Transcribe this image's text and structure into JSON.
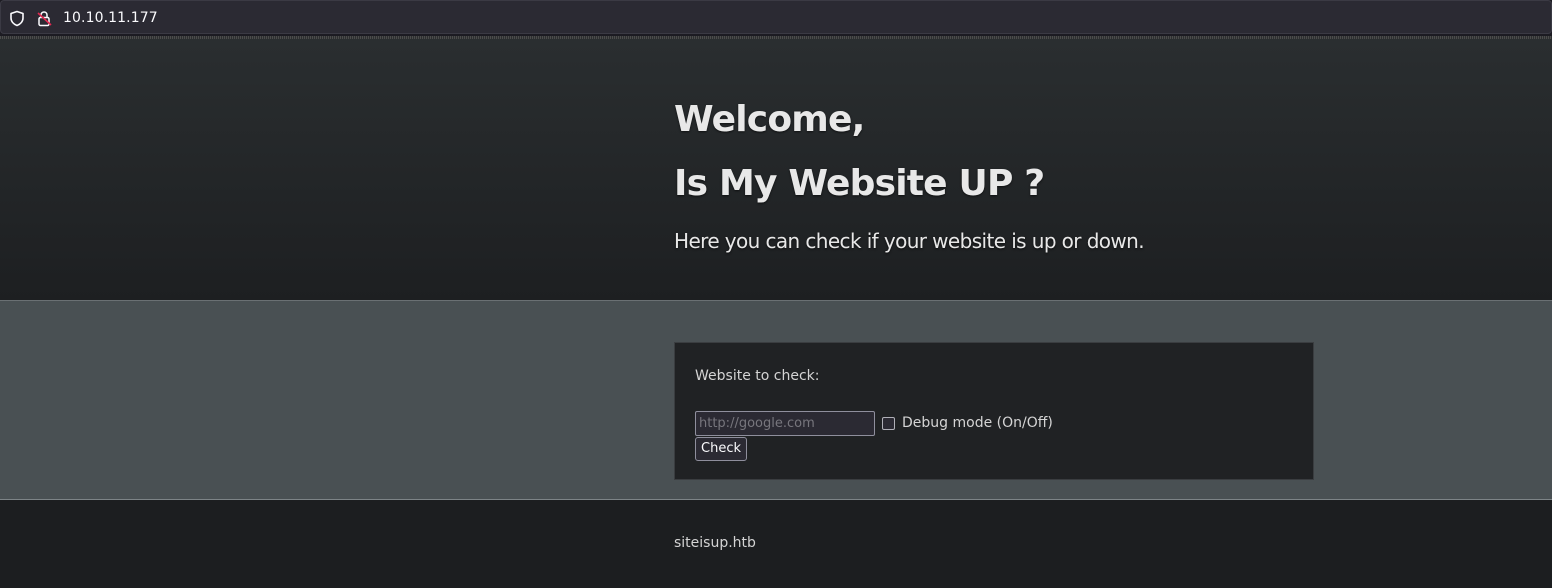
{
  "browser": {
    "url": "10.10.11.177",
    "icons": [
      "shield-icon",
      "lock-icon"
    ]
  },
  "hero": {
    "title_line1": "Welcome,",
    "title_line2": "Is My Website UP ?",
    "subtitle": "Here you can check if your website is up or down."
  },
  "form": {
    "label": "Website to check:",
    "input_value": "",
    "input_placeholder": "http://google.com",
    "debug_label": "Debug mode (On/Off)",
    "debug_checked": false,
    "submit_label": "Check"
  },
  "footer": {
    "text": "siteisup.htb"
  },
  "colors": {
    "hero_text": "#e8e8e8",
    "band_bg": "#495053",
    "panel_bg": "#202224",
    "footer_bg": "#1c1e20"
  }
}
